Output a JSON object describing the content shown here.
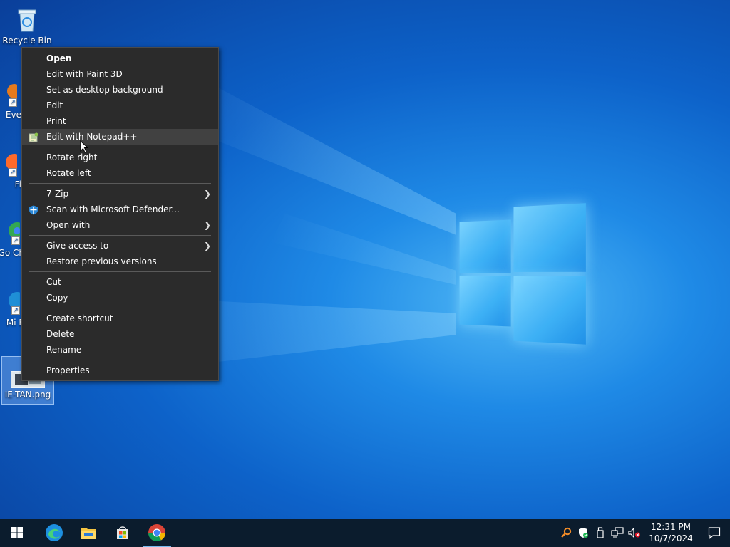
{
  "desktop": {
    "icons": [
      {
        "label": "Recycle Bin",
        "icon": "recycle-bin-icon"
      },
      {
        "label": "Eve",
        "icon": "everything-icon"
      },
      {
        "label": "Fi",
        "icon": "firefox-icon"
      },
      {
        "label": "Go Ch",
        "icon": "chrome-icon"
      },
      {
        "label": "Mi E",
        "icon": "edge-icon"
      },
      {
        "label": "IE-TAN.png",
        "icon": "image-file-icon"
      }
    ]
  },
  "context_menu": {
    "items": [
      {
        "label": "Open"
      },
      {
        "label": "Edit with Paint 3D"
      },
      {
        "label": "Set as desktop background"
      },
      {
        "label": "Edit"
      },
      {
        "label": "Print"
      },
      {
        "label": "Edit with Notepad++"
      },
      {
        "label": "Rotate right"
      },
      {
        "label": "Rotate left"
      },
      {
        "label": "7-Zip"
      },
      {
        "label": "Scan with Microsoft Defender..."
      },
      {
        "label": "Open with"
      },
      {
        "label": "Give access to"
      },
      {
        "label": "Restore previous versions"
      },
      {
        "label": "Cut"
      },
      {
        "label": "Copy"
      },
      {
        "label": "Create shortcut"
      },
      {
        "label": "Delete"
      },
      {
        "label": "Rename"
      },
      {
        "label": "Properties"
      }
    ]
  },
  "taskbar": {
    "apps": [
      "start-icon",
      "edge-icon",
      "file-explorer-icon",
      "microsoft-store-icon",
      "chrome-icon"
    ],
    "tray": {
      "time": "12:31 PM",
      "date": "10/7/2024"
    }
  },
  "colors": {
    "menu_bg": "#2b2b2b",
    "menu_hover": "#414141",
    "taskbar_bg": "#0b1c2d"
  }
}
